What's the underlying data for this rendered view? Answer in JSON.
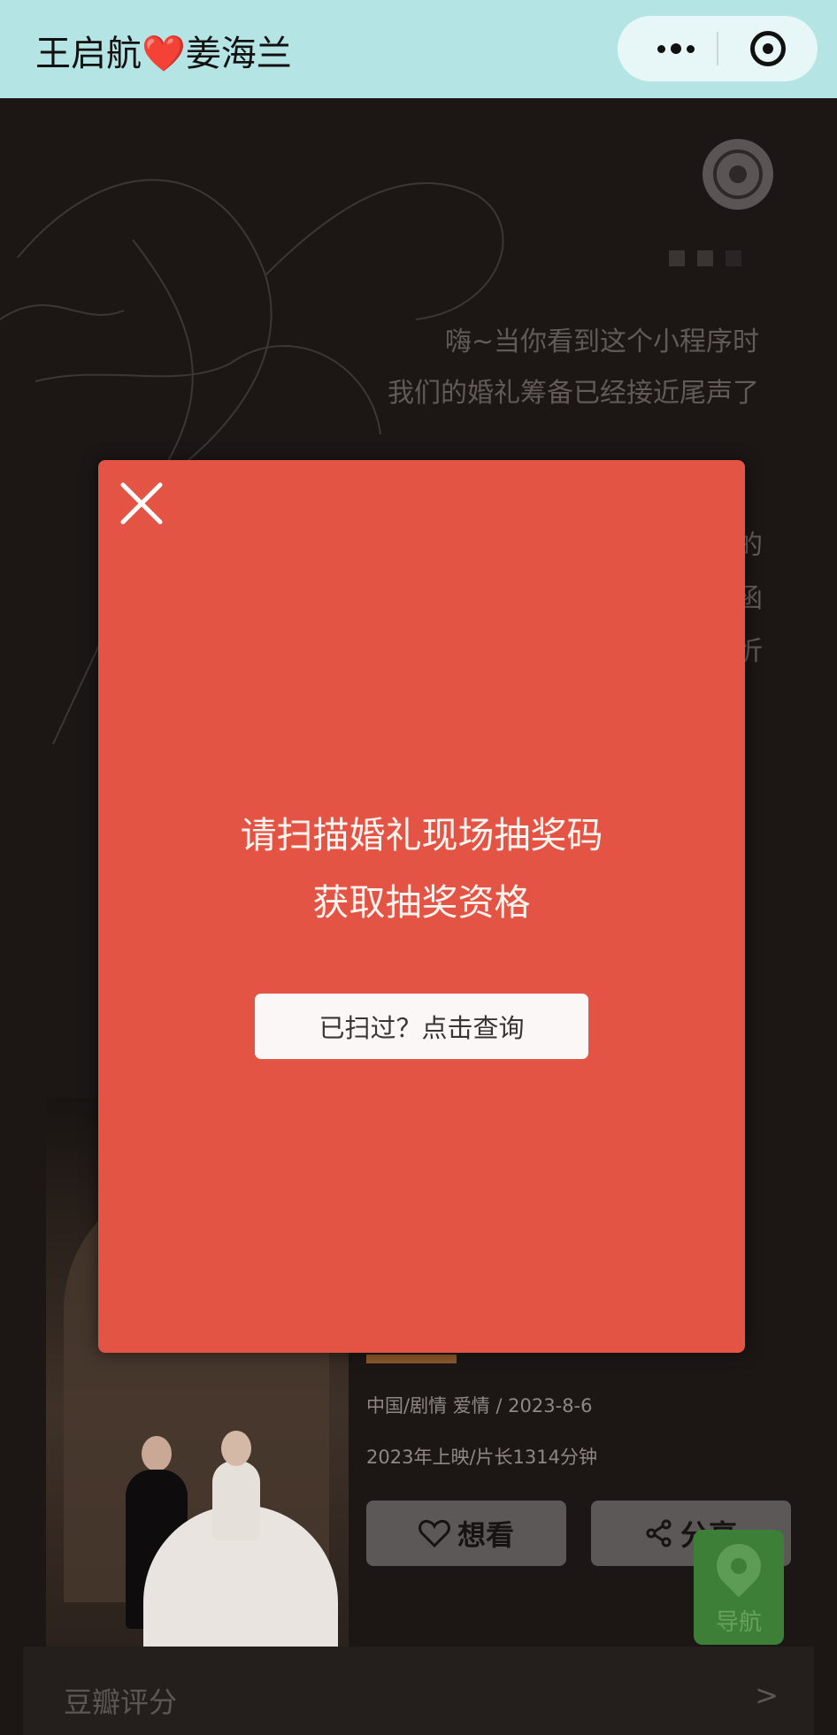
{
  "header": {
    "title_prefix": "王启航",
    "heart": "❤️",
    "title_suffix": "姜海兰",
    "more_icon": "more-dots-icon",
    "close_icon": "target-circle-icon"
  },
  "background": {
    "intro_lines": [
      "嗨~当你看到这个小程序时",
      "我们的婚礼筹备已经接近尾声了"
    ],
    "fragments": [
      "的",
      "函",
      "忻"
    ],
    "meta_line_1": "中国/剧情 爱情 / 2023-8-6",
    "meta_line_2": "2023年上映/片长1314分钟",
    "want_label": "想看",
    "share_label": "分享",
    "douban_label": "豆瓣评分",
    "douban_arrow": ">",
    "nav_label": "导航"
  },
  "modal": {
    "line1": "请扫描婚礼现场抽奖码",
    "line2": "获取抽奖资格",
    "button_label": "已扫过？点击查询"
  },
  "colors": {
    "header_bg": "#b4e4e4",
    "page_bg": "#1c1715",
    "modal_bg": "#e35444",
    "nav_button": "#3d7f36"
  }
}
